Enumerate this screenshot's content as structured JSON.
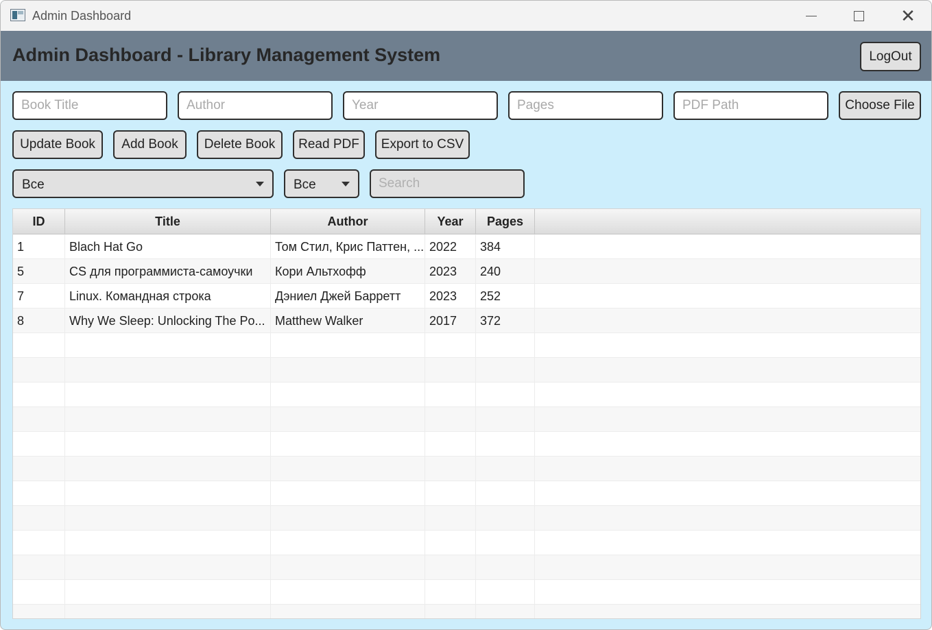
{
  "window": {
    "title": "Admin Dashboard"
  },
  "header": {
    "title": "Admin Dashboard - Library Management System",
    "logout_label": "LogOut"
  },
  "form": {
    "book_title_placeholder": "Book Title",
    "author_placeholder": "Author",
    "year_placeholder": "Year",
    "pages_placeholder": "Pages",
    "pdf_path_placeholder": "PDF Path",
    "choose_file_label": "Choose File"
  },
  "actions": {
    "update_label": "Update Book",
    "add_label": "Add Book",
    "delete_label": "Delete Book",
    "read_pdf_label": "Read PDF",
    "export_label": "Export to CSV"
  },
  "filters": {
    "filter1_value": "Все",
    "filter2_value": "Все",
    "search_placeholder": "Search"
  },
  "table": {
    "columns": [
      "ID",
      "Title",
      "Author",
      "Year",
      "Pages"
    ],
    "rows": [
      {
        "id": "1",
        "title": "Blach Hat Go",
        "author": "Том Стил, Крис Паттен, ...",
        "year": "2022",
        "pages": "384"
      },
      {
        "id": "5",
        "title": "CS для программиста-самоучки",
        "author": "Кори Альтхофф",
        "year": "2023",
        "pages": "240"
      },
      {
        "id": "7",
        "title": "Linux. Командная строка",
        "author": "Дэниел Джей Барретт",
        "year": "2023",
        "pages": "252"
      },
      {
        "id": "8",
        "title": "Why We Sleep: Unlocking The Po...",
        "author": "Matthew Walker",
        "year": "2017",
        "pages": "372"
      }
    ]
  }
}
